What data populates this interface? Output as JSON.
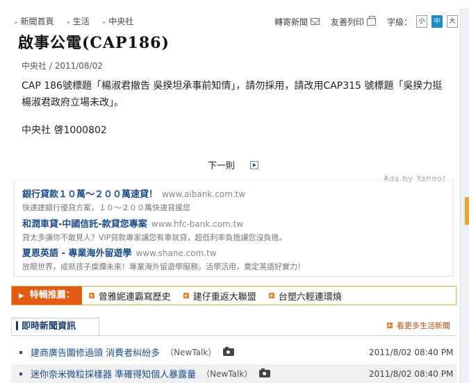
{
  "breadcrumb": [
    "新聞首頁",
    "生活",
    "中央社"
  ],
  "tools": {
    "forward": "轉寄新聞",
    "print": "友善列印",
    "font_label": "字級：",
    "font_sizes": [
      "小",
      "中",
      "大"
    ],
    "active_font_size": "中"
  },
  "article": {
    "title": "啟事公電(CAP186)",
    "source": "中央社",
    "date": "2011/08/02",
    "body": "CAP 186號標題「楊淑君撤告 吳揆坦承事前知情」，請勿採用，請改用CAP315 號標題「吳揆力挺楊淑君政府立場未改」。",
    "signature": "中央社 啓1000802"
  },
  "next_label": "下一則",
  "ads": {
    "label": "Ads by Yahoo!",
    "items": [
      {
        "title": "銀行貸款１０萬～２００萬速貸！",
        "url": "www.aibank.com.tw",
        "desc": "快速建銀行優貸方案，１０～２００萬快速貸援您"
      },
      {
        "title": "和潤車貸-中國信託-款貸您專案",
        "url": "www.hfc-bank.com.tw",
        "desc": "貸太多讓你不敢見人？VIP貸款專家讓您有車就貸，超低利率負擔讓您沒負擔。"
      },
      {
        "title": "夏恩英語 - 專業海外留遊學",
        "url": "www.shane.com.tw",
        "desc": "放眼世界，成就孩子燦爛未來！專業海外留遊學服務，活學活用，奠定英語好實力！"
      }
    ]
  },
  "feature": {
    "label": "特輯推薦：",
    "links": [
      "曾雅妮連霸寫歷史",
      "建仔重返大聯盟",
      "台塑六輕連環燒"
    ]
  },
  "news": {
    "tab": "即時新聞資訊",
    "more": "看更多生活新聞",
    "items": [
      {
        "headline": "建商廣告圖修過頭 消費者糾紛多",
        "source": "（NewTalk）",
        "time": "2011/8/02 08:40 PM"
      },
      {
        "headline": "迷你奈米微粒採樣器 準確得知個人暴露量",
        "source": "（NewTalk）",
        "time": "2011/8/02 08:40 PM"
      }
    ]
  }
}
